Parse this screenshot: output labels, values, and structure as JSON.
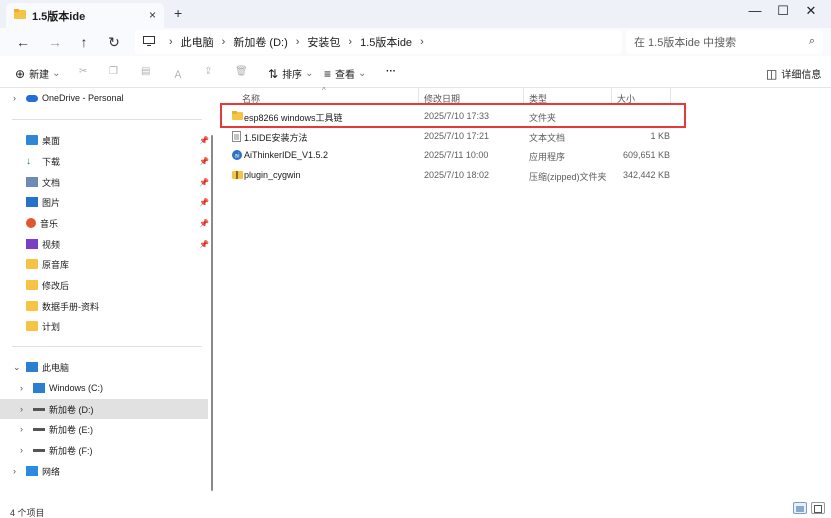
{
  "window": {
    "tab_title": "1.5版本ide",
    "tab_close": "×",
    "new_tab": "+",
    "minimize": "—",
    "maximize": "☐",
    "close": "✕"
  },
  "nav": {
    "back": "←",
    "forward": "→",
    "up": "↑",
    "refresh": "↻"
  },
  "breadcrumb": [
    "此电脑",
    "新加卷 (D:)",
    "安装包",
    "1.5版本ide"
  ],
  "search": {
    "placeholder": "在 1.5版本ide 中搜索"
  },
  "toolbar": {
    "new_label": "新建",
    "sort_label": "排序",
    "view_label": "查看",
    "more_label": "···",
    "details_label": "详细信息"
  },
  "sidebar": {
    "onedrive": "OneDrive - Personal",
    "quick": [
      {
        "label": "桌面",
        "icon": "desktop-icon"
      },
      {
        "label": "下载",
        "icon": "download-icon"
      },
      {
        "label": "文档",
        "icon": "documents-icon"
      },
      {
        "label": "图片",
        "icon": "pictures-icon"
      },
      {
        "label": "音乐",
        "icon": "music-icon"
      },
      {
        "label": "视频",
        "icon": "videos-icon"
      },
      {
        "label": "原音库",
        "icon": "folder-icon"
      },
      {
        "label": "修改后",
        "icon": "folder-icon"
      },
      {
        "label": "数据手册-资料",
        "icon": "folder-icon"
      },
      {
        "label": "计划",
        "icon": "folder-icon"
      }
    ],
    "this_pc": "此电脑",
    "drives": [
      {
        "label": "Windows (C:)"
      },
      {
        "label": "新加卷 (D:)"
      },
      {
        "label": "新加卷 (E:)"
      },
      {
        "label": "新加卷 (F:)"
      }
    ],
    "network": "网络"
  },
  "columns": {
    "name": "名称",
    "date": "修改日期",
    "type": "类型",
    "size": "大小"
  },
  "files": [
    {
      "name": "esp8266 windows工具链",
      "date": "2025/7/10 17:33",
      "type": "文件夹",
      "size": "",
      "icon": "folder-icon"
    },
    {
      "name": "1.5IDE安装方法",
      "date": "2025/7/10 17:21",
      "type": "文本文档",
      "size": "1 KB",
      "icon": "text-file-icon"
    },
    {
      "name": "AiThinkerIDE_V1.5.2",
      "date": "2025/7/11 10:00",
      "type": "应用程序",
      "size": "609,651 KB",
      "icon": "app-icon"
    },
    {
      "name": "plugin_cygwin",
      "date": "2025/7/10 18:02",
      "type": "压缩(zipped)文件夹",
      "size": "342,442 KB",
      "icon": "zip-folder-icon"
    }
  ],
  "status": {
    "item_count": "4 个项目"
  }
}
